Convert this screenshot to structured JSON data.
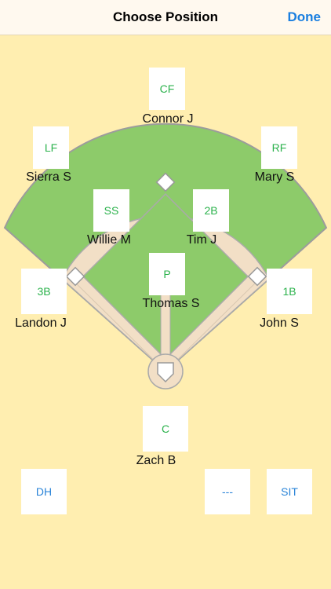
{
  "header": {
    "title": "Choose Position",
    "done_label": "Done"
  },
  "positions": {
    "cf": {
      "label": "CF",
      "player": "Connor J"
    },
    "lf": {
      "label": "LF",
      "player": "Sierra S"
    },
    "rf": {
      "label": "RF",
      "player": "Mary S"
    },
    "ss": {
      "label": "SS",
      "player": "Willie M"
    },
    "b2": {
      "label": "2B",
      "player": "Tim J"
    },
    "b3": {
      "label": "3B",
      "player": "Landon J"
    },
    "p": {
      "label": "P",
      "player": "Thomas S"
    },
    "b1": {
      "label": "1B",
      "player": "John S"
    },
    "c": {
      "label": "C",
      "player": "Zach B"
    }
  },
  "extras": {
    "dh": "DH",
    "blank": "---",
    "sit": "SIT"
  },
  "colors": {
    "background": "#FFEEB0",
    "outfield_grass": "#8DCB6A",
    "infield_dirt": "#F2DFC6",
    "position_text": "#2BB24C",
    "extra_text": "#2A84D8",
    "accent": "#1A7FE0"
  }
}
